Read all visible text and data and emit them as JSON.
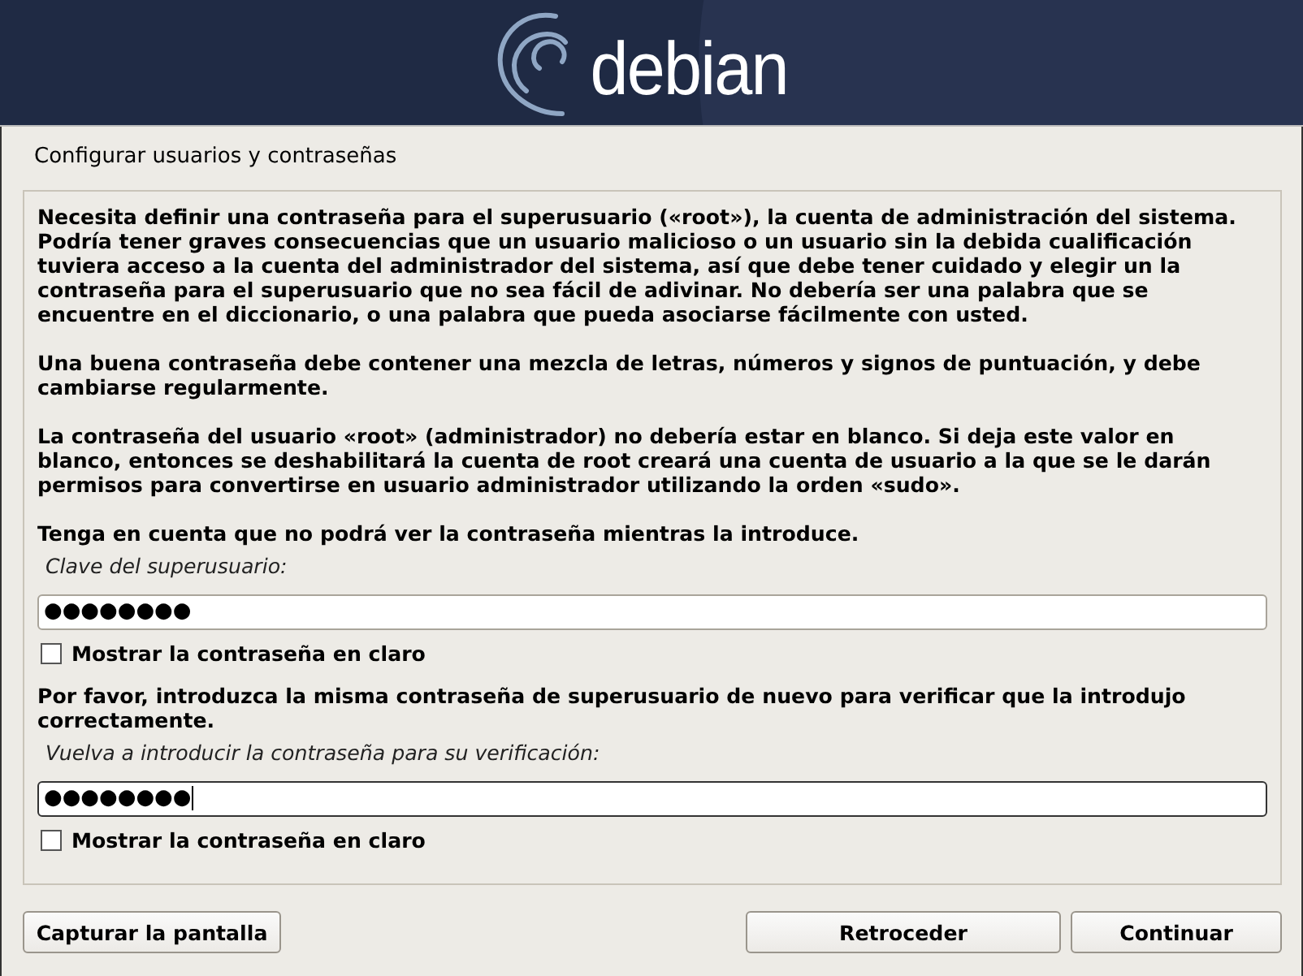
{
  "banner": {
    "logo_text": "debian"
  },
  "title": "Configurar usuarios y contraseñas",
  "paragraphs": [
    "Necesita definir una contraseña para el superusuario («root»), la cuenta de administración del sistema. Podría tener graves consecuencias que un usuario malicioso o un usuario sin la debida cualificación tuviera acceso a la cuenta del administrador del sistema, así que debe tener cuidado y elegir un la contraseña para el superusuario que no sea fácil de adivinar. No debería ser una palabra que se encuentre en el diccionario, o una palabra que pueda asociarse fácilmente con usted.",
    "Una buena contraseña debe contener una mezcla de letras, números y signos de puntuación, y debe cambiarse regularmente.",
    "La contraseña del usuario «root» (administrador) no debería estar en blanco. Si deja este valor en blanco, entonces se deshabilitará la cuenta de root creará una cuenta de usuario a la que se le darán permisos para convertirse en usuario administrador utilizando la orden «sudo».",
    "Tenga en cuenta que no podrá ver la contraseña mientras la introduce."
  ],
  "fields": [
    {
      "label": "Clave del superusuario:",
      "value": "●●●●●●●●",
      "focused": false,
      "checkbox": {
        "label": "Mostrar la contraseña en claro",
        "checked": false
      }
    },
    {
      "intro": "Por favor, introduzca la misma contraseña de superusuario de nuevo para verificar que la introdujo correctamente.",
      "label": "Vuelva a introducir la contraseña para su verificación:",
      "value": "●●●●●●●●",
      "focused": true,
      "checkbox": {
        "label": "Mostrar la contraseña en claro",
        "checked": false
      }
    }
  ],
  "buttons": {
    "left": [
      {
        "label": "Capturar la pantalla"
      }
    ],
    "right": [
      {
        "label": "Retroceder"
      },
      {
        "label": "Continuar"
      }
    ]
  }
}
